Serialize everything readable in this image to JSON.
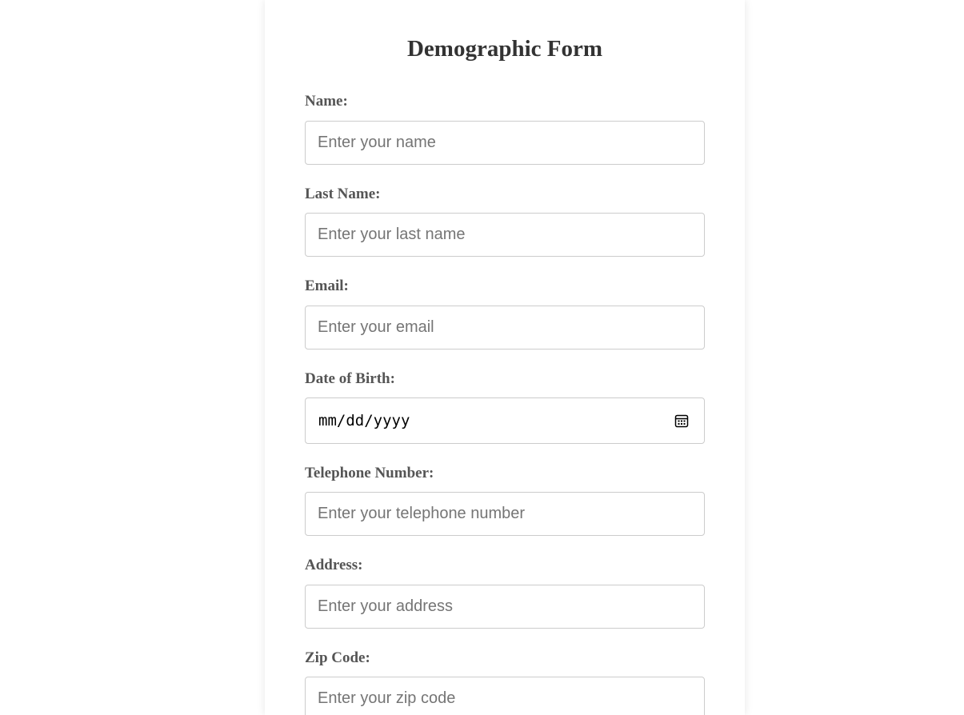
{
  "form": {
    "title": "Demographic Form",
    "fields": [
      {
        "label": "Name:",
        "placeholder": "Enter your name"
      },
      {
        "label": "Last Name:",
        "placeholder": "Enter your last name"
      },
      {
        "label": "Email:",
        "placeholder": "Enter your email"
      },
      {
        "label": "Date of Birth:",
        "value": "mm/dd/yyyy",
        "icon": "calendar-icon"
      },
      {
        "label": "Telephone Number:",
        "placeholder": "Enter your telephone number"
      },
      {
        "label": "Address:",
        "placeholder": "Enter your address"
      },
      {
        "label": "Zip Code:",
        "placeholder": "Enter your zip code"
      }
    ]
  },
  "colors": {
    "background": "#ffffff",
    "title": "#333333",
    "label": "#555555",
    "input_border": "#cccccc",
    "placeholder": "#757575"
  }
}
